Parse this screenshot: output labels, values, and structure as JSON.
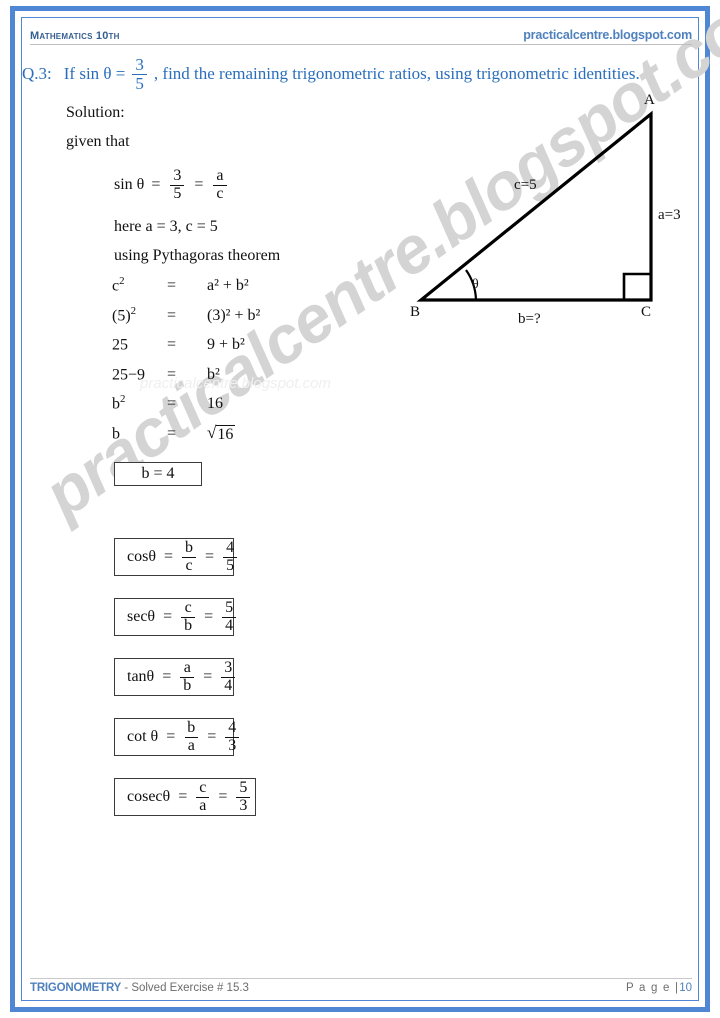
{
  "theme": {
    "border_blue": "#4f87d4",
    "heading_blue": "#2a6ebb",
    "accent_blue": "#4f81bd",
    "body_black": "#111111",
    "watermark_gray": "#d4d4d4"
  },
  "header": {
    "left": "Mathematics 10th",
    "right": "practicalcentre.blogspot.com"
  },
  "watermarks": {
    "large": "practicalcentre.blogspot.com",
    "small": "practicalcentre.blogspot.com"
  },
  "question": {
    "label": "Q.3:",
    "text_before": "If sin θ =",
    "fraction": {
      "numerator": "3",
      "denominator": "5"
    },
    "text_after": ", find the remaining trigonometric ratios, using trigonometric identities."
  },
  "solution": {
    "heading": "Solution:",
    "given_label": "given that",
    "sin_equation": {
      "lhs": "sin θ",
      "eq1": "=",
      "frac1": {
        "numerator": "3",
        "denominator": "5"
      },
      "eq2": "=",
      "frac2": {
        "numerator": "a",
        "denominator": "c"
      }
    },
    "here_line": "here  a  = 3,  c = 5",
    "theorem_line": "using Pythagoras theorem",
    "steps": [
      {
        "lhs": "c",
        "lhs_sup": "2",
        "eq": "=",
        "rhs": "a² + b²"
      },
      {
        "lhs": "(5)",
        "lhs_sup": "2",
        "eq": "=",
        "rhs": "(3)² + b²"
      },
      {
        "lhs": "25",
        "lhs_sup": "",
        "eq": "=",
        "rhs": "9 + b²"
      },
      {
        "lhs": "25−9",
        "lhs_sup": "",
        "eq": "=",
        "rhs": "b²"
      },
      {
        "lhs": "b",
        "lhs_sup": "2",
        "eq": "=",
        "rhs": "16"
      },
      {
        "lhs": "b",
        "lhs_sup": "",
        "eq": "=",
        "rhs": "√16"
      }
    ],
    "result_box": "b   =   4",
    "radicand": "16"
  },
  "ratios": [
    {
      "name": "cos",
      "fn_label": "cosθ",
      "eq1": "=",
      "ratio": {
        "numerator": "b",
        "denominator": "c"
      },
      "eq2": "=",
      "value": {
        "numerator": "4",
        "denominator": "5"
      }
    },
    {
      "name": "sec",
      "fn_label": "secθ",
      "eq1": "=",
      "ratio": {
        "numerator": "c",
        "denominator": "b"
      },
      "eq2": "=",
      "value": {
        "numerator": "5",
        "denominator": "4"
      }
    },
    {
      "name": "tan",
      "fn_label": "tanθ",
      "eq1": "=",
      "ratio": {
        "numerator": "a",
        "denominator": "b"
      },
      "eq2": "=",
      "value": {
        "numerator": "3",
        "denominator": "4"
      }
    },
    {
      "name": "cot",
      "fn_label": "cot θ",
      "eq1": "=",
      "ratio": {
        "numerator": "b",
        "denominator": "a"
      },
      "eq2": "=",
      "value": {
        "numerator": "4",
        "denominator": "3"
      }
    },
    {
      "name": "cosec",
      "fn_label": "cosecθ",
      "eq1": "=",
      "ratio": {
        "numerator": "c",
        "denominator": "a"
      },
      "eq2": "=",
      "value": {
        "numerator": "5",
        "denominator": "3"
      }
    }
  ],
  "diagram": {
    "type": "right-triangle",
    "vertices": {
      "A": "A",
      "B": "B",
      "C": "C"
    },
    "sides": {
      "hypotenuse": "c=5",
      "opposite": "a=3",
      "adjacent": "b=?"
    },
    "angle": "θ",
    "right_angle_at": "C"
  },
  "footer": {
    "chapter": "TRIGONOMETRY",
    "exercise": " - Solved Exercise # 15.3",
    "page_label": "P a g e  |",
    "page_number": "10"
  }
}
